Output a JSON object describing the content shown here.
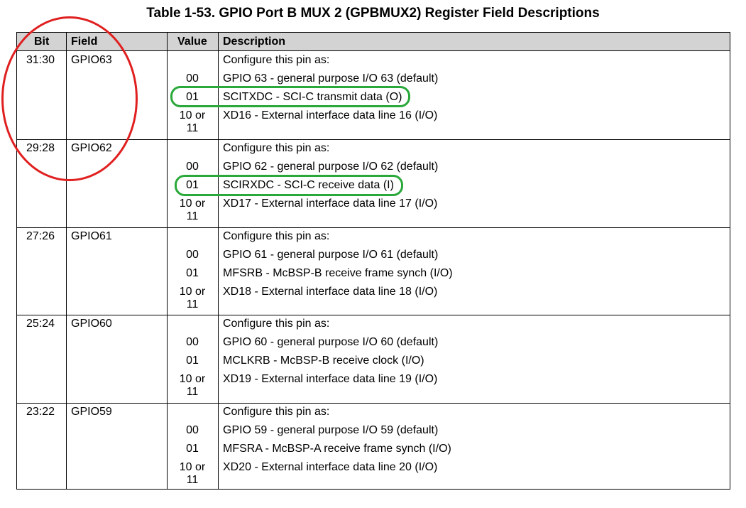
{
  "title": "Table 1-53. GPIO Port B MUX 2 (GPBMUX2) Register Field Descriptions",
  "headers": {
    "bit": "Bit",
    "field": "Field",
    "value": "Value",
    "description": "Description"
  },
  "rows": [
    {
      "bit": "31:30",
      "field": "GPIO63",
      "entries": [
        {
          "value": "",
          "desc": "Configure this pin as:"
        },
        {
          "value": "00",
          "desc": "GPIO 63 - general purpose I/O 63 (default)"
        },
        {
          "value": "01",
          "desc": "SCITXDC - SCI-C transmit data (O)"
        },
        {
          "value_line1": "10 or",
          "value_line2": "11",
          "desc": "XD16 - External interface data line 16 (I/O)"
        }
      ]
    },
    {
      "bit": "29:28",
      "field": "GPIO62",
      "entries": [
        {
          "value": "",
          "desc": "Configure this pin as:"
        },
        {
          "value": "00",
          "desc": "GPIO 62 - general purpose I/O 62 (default)"
        },
        {
          "value": "01",
          "desc": "SCIRXDC - SCI-C receive data (I)"
        },
        {
          "value_line1": "10 or",
          "value_line2": "11",
          "desc": "XD17 - External interface data line 17 (I/O)"
        }
      ]
    },
    {
      "bit": "27:26",
      "field": "GPIO61",
      "entries": [
        {
          "value": "",
          "desc": "Configure this pin as:"
        },
        {
          "value": "00",
          "desc": "GPIO 61 - general purpose I/O 61 (default)"
        },
        {
          "value": "01",
          "desc": "MFSRB - McBSP-B receive frame synch (I/O)"
        },
        {
          "value_line1": "10 or",
          "value_line2": "11",
          "desc": "XD18 - External interface data line 18 (I/O)"
        }
      ]
    },
    {
      "bit": "25:24",
      "field": "GPIO60",
      "entries": [
        {
          "value": "",
          "desc": "Configure this pin as:"
        },
        {
          "value": "00",
          "desc": "GPIO 60 - general purpose I/O 60 (default)"
        },
        {
          "value": "01",
          "desc": "MCLKRB - McBSP-B receive clock (I/O)"
        },
        {
          "value_line1": "10 or",
          "value_line2": "11",
          "desc": "XD19 - External interface data line 19 (I/O)"
        }
      ]
    },
    {
      "bit": "23:22",
      "field": "GPIO59",
      "entries": [
        {
          "value": "",
          "desc": "Configure this pin as:"
        },
        {
          "value": "00",
          "desc": "GPIO 59 - general purpose I/O 59 (default)"
        },
        {
          "value": "01",
          "desc": "MFSRA - McBSP-A receive frame synch (I/O)"
        },
        {
          "value_line1": "10 or",
          "value_line2": "11",
          "desc": "XD20 - External interface data line 20 (I/O)"
        }
      ]
    }
  ],
  "annotations": {
    "red_ellipse_color": "#e02020",
    "green_highlight_color": "#2aa83a"
  }
}
